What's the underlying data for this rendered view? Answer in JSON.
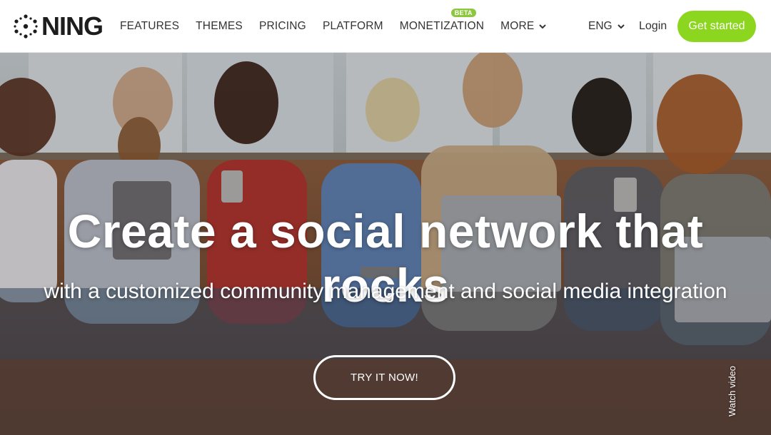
{
  "header": {
    "logo_text": "NING",
    "nav": [
      {
        "label": "FEATURES"
      },
      {
        "label": "THEMES"
      },
      {
        "label": "PRICING"
      },
      {
        "label": "PLATFORM"
      },
      {
        "label": "MONETIZATION",
        "badge": "BETA"
      },
      {
        "label": "MORE"
      }
    ],
    "language": "ENG",
    "login": "Login",
    "cta": "Get started"
  },
  "hero": {
    "title": "Create a social network that rocks",
    "subtitle": "with a customized community management and social media integration",
    "button": "TRY IT NOW!",
    "watch_video": "Watch video"
  },
  "colors": {
    "accent": "#8dd620",
    "badge": "#8dc63f",
    "text_dark": "#333333"
  },
  "icons": {
    "logo": "ning-dots-icon",
    "dropdown": "chevron-down-icon"
  }
}
